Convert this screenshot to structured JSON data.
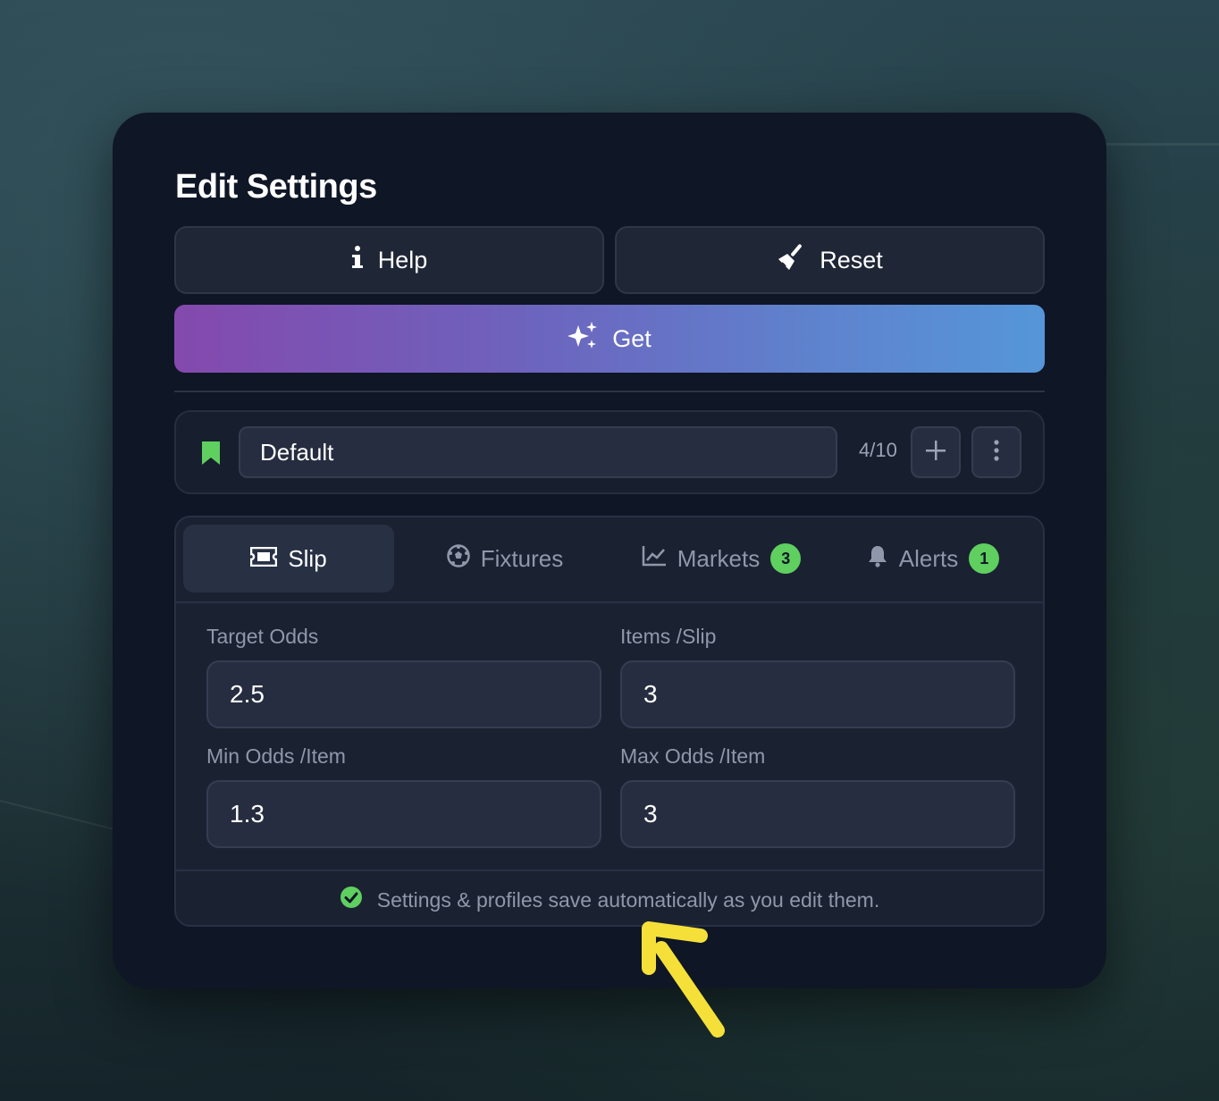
{
  "dialog": {
    "title": "Edit Settings"
  },
  "actions": {
    "help_label": "Help",
    "reset_label": "Reset",
    "get_label": "Get"
  },
  "profile": {
    "name": "Default",
    "count": "4/10"
  },
  "tabs": [
    {
      "label": "Slip",
      "icon": "ticket-icon",
      "active": true
    },
    {
      "label": "Fixtures",
      "icon": "soccer-ball-icon",
      "active": false
    },
    {
      "label": "Markets",
      "icon": "line-chart-icon",
      "badge": "3",
      "active": false
    },
    {
      "label": "Alerts",
      "icon": "bell-icon",
      "badge": "1",
      "active": false
    }
  ],
  "fields": {
    "target_odds": {
      "label": "Target Odds",
      "value": "2.5"
    },
    "items_per_slip": {
      "label": "Items /Slip",
      "value": "3"
    },
    "min_odds": {
      "label": "Min Odds /Item",
      "value": "1.3"
    },
    "max_odds": {
      "label": "Max Odds /Item",
      "value": "3"
    }
  },
  "footer": {
    "text": "Settings & profiles save automatically as you edit them."
  },
  "colors": {
    "accent_green": "#5fcf60",
    "gradient_start": "#8449ad",
    "gradient_end": "#5596d9",
    "arrow": "#f5e03a"
  }
}
